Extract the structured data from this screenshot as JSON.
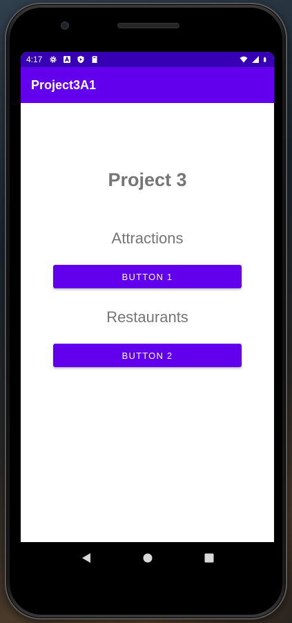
{
  "status_bar": {
    "time": "4:17",
    "left_icons": [
      "settings-icon",
      "a-badge-icon",
      "shield-icon",
      "sd-card-icon"
    ],
    "right_icons": [
      "wifi-icon",
      "signal-icon",
      "battery-icon"
    ],
    "background": "#3700b3"
  },
  "app_bar": {
    "title": "Project3A1",
    "background": "#6200ee"
  },
  "main": {
    "title": "Project 3",
    "attractions_label": "Attractions",
    "button1_label": "BUTTON 1",
    "restaurants_label": "Restaurants",
    "button2_label": "BUTTON 2"
  },
  "nav_bar": {
    "buttons": [
      "back-icon",
      "home-icon",
      "recents-icon"
    ]
  },
  "colors": {
    "accent": "#6200ee",
    "status": "#3700b3",
    "text_gray": "#757575"
  }
}
